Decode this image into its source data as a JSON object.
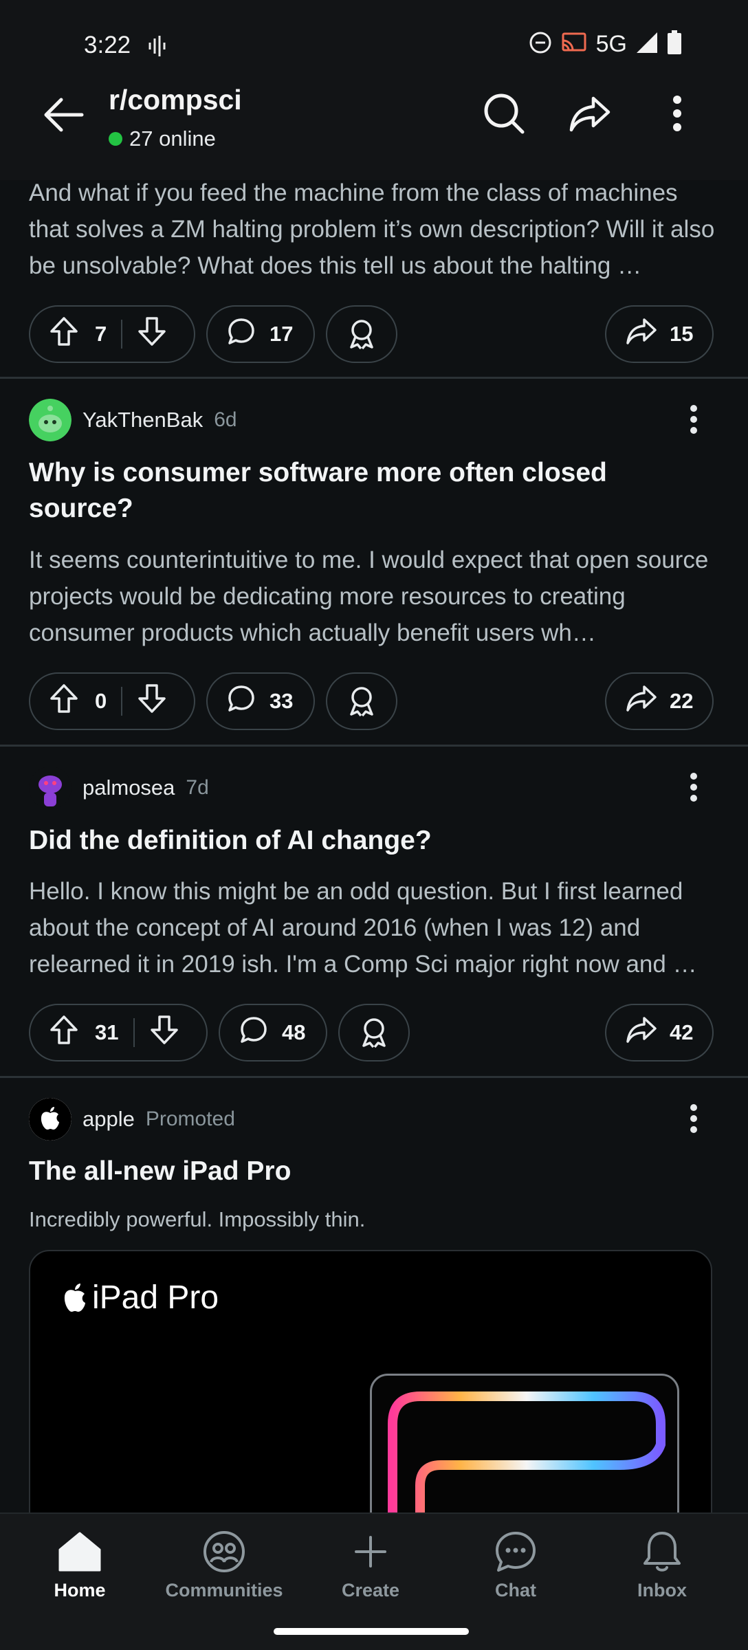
{
  "status": {
    "time": "3:22",
    "network": "5G"
  },
  "header": {
    "subreddit": "r/compsci",
    "online": "27 online"
  },
  "posts": [
    {
      "excerpt": "And what if you feed the machine from the class of machines that solves a ZM halting problem it’s own description? Will it also be unsolvable? What does this tell us about the halting …",
      "votes": "7",
      "comments": "17",
      "shares": "15"
    },
    {
      "author": "YakThenBak",
      "age": "6d",
      "title": "Why is consumer software more often closed source?",
      "excerpt": "It seems counterintuitive to me. I would expect that open source projects would be dedicating more resources to creating consumer products which actually benefit users wh…",
      "votes": "0",
      "comments": "33",
      "shares": "22"
    },
    {
      "author": "palmosea",
      "age": "7d",
      "title": "Did the definition of AI change?",
      "excerpt": "Hello. I know this might be an odd question. But I first learned about the concept of AI around 2016 (when I was 12) and relearned it in 2019 ish. I'm a Comp Sci major right now and …",
      "votes": "31",
      "comments": "48",
      "shares": "42"
    }
  ],
  "promoted": {
    "author": "apple",
    "tag": "Promoted",
    "title": "The all-new iPad Pro",
    "subtitle": "Incredibly powerful. Impossibly thin.",
    "card_logo_text": "iPad Pro"
  },
  "nav": {
    "home": "Home",
    "communities": "Communities",
    "create": "Create",
    "chat": "Chat",
    "inbox": "Inbox"
  },
  "colors": {
    "background": "#0e1113",
    "online_dot": "#23c343",
    "avatar_green": "#46d160",
    "avatar_purple": "#8b3fd6"
  }
}
